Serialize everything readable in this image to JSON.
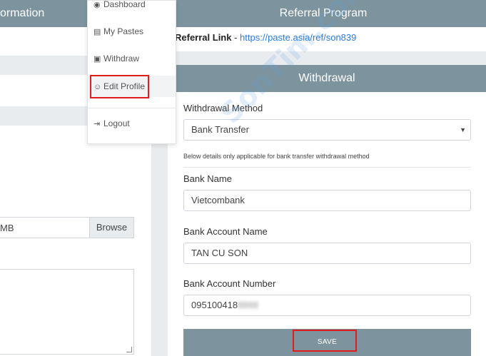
{
  "left_panel": {
    "header_title": "ormation",
    "file_input_text": "MB",
    "browse_label": "Browse"
  },
  "menu": {
    "items": [
      {
        "icon": "dashboard-icon",
        "glyph": "◉",
        "label": "Dashboard"
      },
      {
        "icon": "pastes-icon",
        "glyph": "▤",
        "label": "My Pastes"
      },
      {
        "icon": "withdraw-icon",
        "glyph": "▣",
        "label": "Withdraw"
      },
      {
        "icon": "user-icon",
        "glyph": "☺",
        "label": "Edit Profile"
      },
      {
        "icon": "logout-icon",
        "glyph": "⇥",
        "label": "Logout"
      }
    ]
  },
  "referral": {
    "title": "Referral Program",
    "link_label": "Referral Link",
    "separator": " - ",
    "link_url": "https://paste.asia/ref/son839"
  },
  "withdrawal": {
    "title": "Withdrawal",
    "method_label": "Withdrawal Method",
    "method_value": "Bank Transfer",
    "note": "Below details only applicable for bank transfer withdrawal method",
    "bank_name_label": "Bank Name",
    "bank_name_value": "Vietcombank",
    "account_name_label": "Bank Account Name",
    "account_name_value": "TAN CU SON",
    "account_number_label": "Bank Account Number",
    "account_number_visible": "095100418",
    "account_number_hidden": "8888",
    "save_label": "SAVE"
  },
  "watermark": "SonTim.com",
  "colors": {
    "header": "#7d949f",
    "link": "#2a7ae2",
    "highlight": "#e01c1c"
  }
}
